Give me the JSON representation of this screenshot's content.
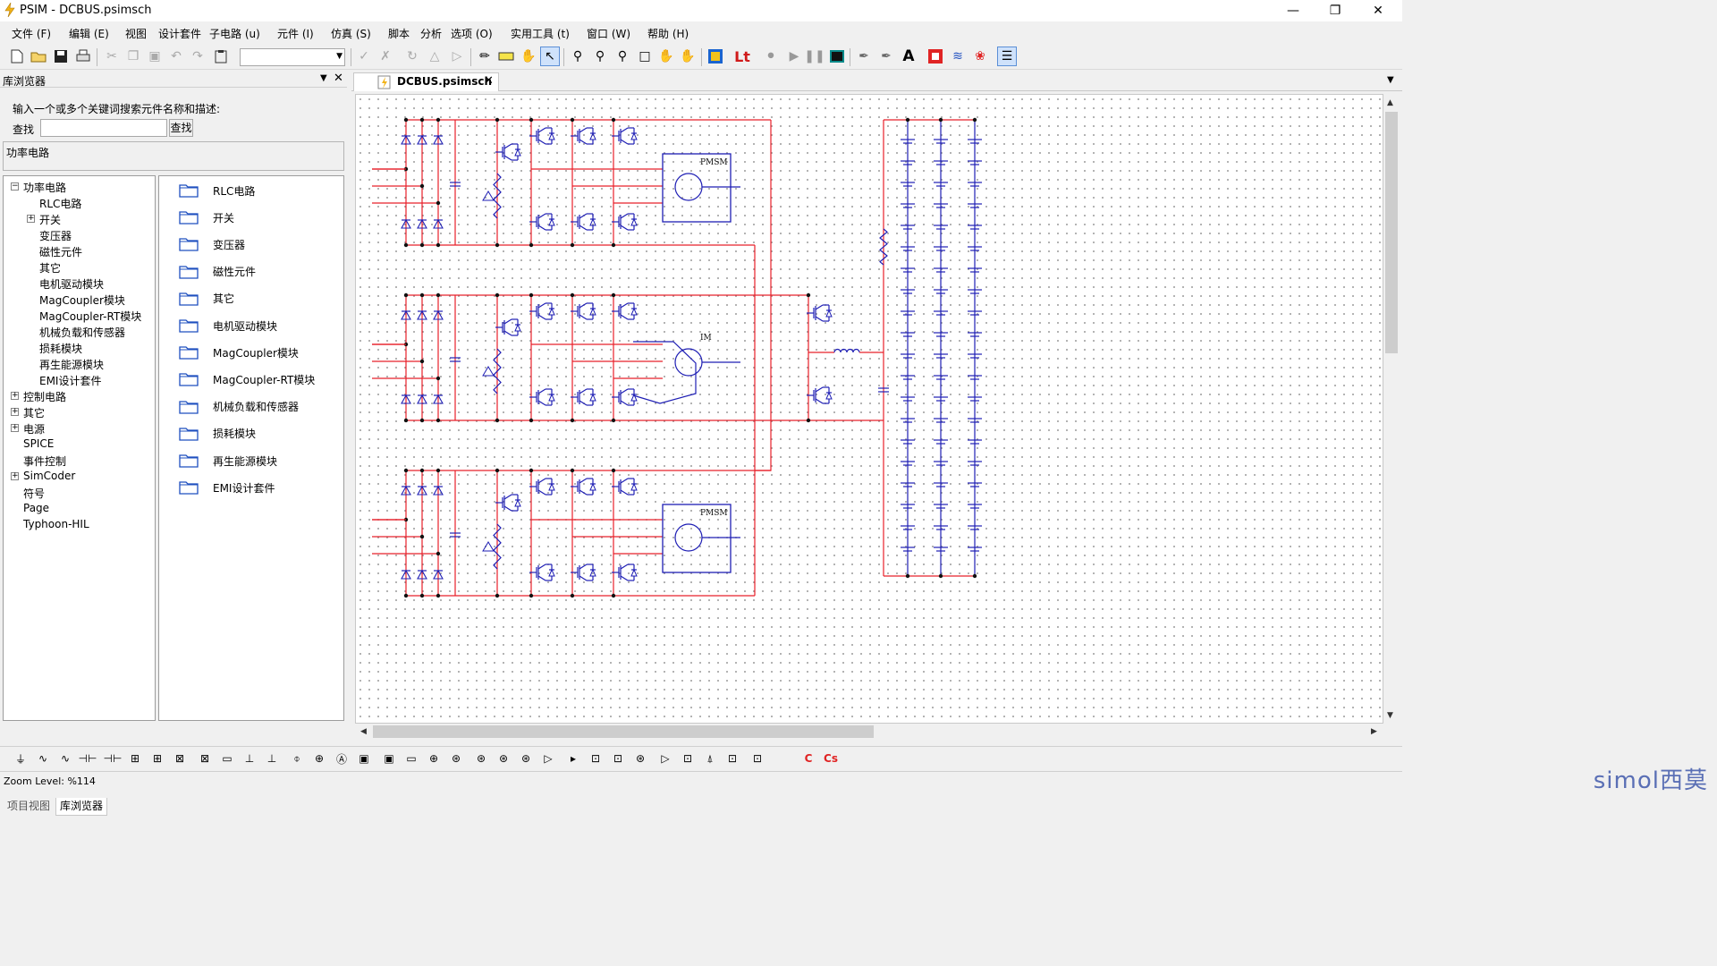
{
  "window": {
    "title": "PSIM - DCBUS.psimsch",
    "controls": [
      "minimize-icon",
      "restore-icon",
      "close-icon"
    ]
  },
  "menu": [
    "文件 (F)",
    "编辑 (E)",
    "视图",
    "设计套件",
    "子电路 (u)",
    "元件 (I)",
    "仿真 (S)",
    "脚本",
    "分析",
    "选项 (O)",
    "实用工具 (t)",
    "窗口 (W)",
    "帮助 (H)"
  ],
  "toolbar": {
    "combo_value": "",
    "icons": [
      "new-file-icon",
      "open-folder-icon",
      "save-icon",
      "print-icon",
      "cut-icon",
      "copy-icon",
      "paste-icon",
      "undo-icon",
      "redo-icon",
      "clipboard-icon",
      "check-icon",
      "cross-icon",
      "rotate-icon",
      "flip-icon",
      "mirror-icon",
      "wire-icon",
      "label-icon",
      "pan-icon",
      "select-icon",
      "zoom-icon",
      "zoom-in-icon",
      "zoom-out-icon",
      "fit-page-icon",
      "hand-icon",
      "grab-icon",
      "simview-icon",
      "lt-icon",
      "stop-icon",
      "run-icon",
      "pause-icon",
      "scope-icon",
      "probe-icon",
      "multi-probe-icon",
      "text-icon",
      "smartctrl-icon",
      "waveform-icon",
      "thermal-icon",
      "list-icon"
    ],
    "lt_label": "Lt",
    "text_tool_label": "A"
  },
  "library": {
    "title": "库浏览器",
    "search_prompt": "输入一个或多个关键词搜索元件名称和描述:",
    "search_label": "查找",
    "search_value": "",
    "search_button": "查找",
    "description": "功率电路",
    "tree": [
      {
        "label": "功率电路",
        "level": 0,
        "expander": "−"
      },
      {
        "label": "RLC电路",
        "level": 1,
        "expander": ""
      },
      {
        "label": "开关",
        "level": 1,
        "expander": "+"
      },
      {
        "label": "变压器",
        "level": 1,
        "expander": ""
      },
      {
        "label": "磁性元件",
        "level": 1,
        "expander": ""
      },
      {
        "label": "其它",
        "level": 1,
        "expander": ""
      },
      {
        "label": "电机驱动模块",
        "level": 1,
        "expander": ""
      },
      {
        "label": "MagCoupler模块",
        "level": 1,
        "expander": ""
      },
      {
        "label": "MagCoupler-RT模块",
        "level": 1,
        "expander": ""
      },
      {
        "label": "机械负载和传感器",
        "level": 1,
        "expander": ""
      },
      {
        "label": "损耗模块",
        "level": 1,
        "expander": ""
      },
      {
        "label": "再生能源模块",
        "level": 1,
        "expander": ""
      },
      {
        "label": "EMI设计套件",
        "level": 1,
        "expander": ""
      },
      {
        "label": "控制电路",
        "level": 0,
        "expander": "+"
      },
      {
        "label": "其它",
        "level": 0,
        "expander": "+"
      },
      {
        "label": "电源",
        "level": 0,
        "expander": "+"
      },
      {
        "label": "SPICE",
        "level": 0,
        "expander": ""
      },
      {
        "label": "事件控制",
        "level": 0,
        "expander": ""
      },
      {
        "label": "SimCoder",
        "level": 0,
        "expander": "+"
      },
      {
        "label": "符号",
        "level": 0,
        "expander": ""
      },
      {
        "label": "Page",
        "level": 0,
        "expander": ""
      },
      {
        "label": "Typhoon-HIL",
        "level": 0,
        "expander": ""
      }
    ],
    "folders": [
      "RLC电路",
      "开关",
      "变压器",
      "磁性元件",
      "其它",
      "电机驱动模块",
      "MagCoupler模块",
      "MagCoupler-RT模块",
      "机械负载和传感器",
      "损耗模块",
      "再生能源模块",
      "EMI设计套件"
    ],
    "bottom_tabs": [
      "项目视图",
      "库浏览器"
    ]
  },
  "document": {
    "tab_label": "DCBUS.psimsch",
    "motor_labels": [
      "PMSM",
      "IM",
      "PMSM"
    ]
  },
  "colors": {
    "wire": "#e8202a",
    "component": "#1e1eb4"
  },
  "status": {
    "zoom": "Zoom Level: %114"
  },
  "watermark": "simol西莫"
}
